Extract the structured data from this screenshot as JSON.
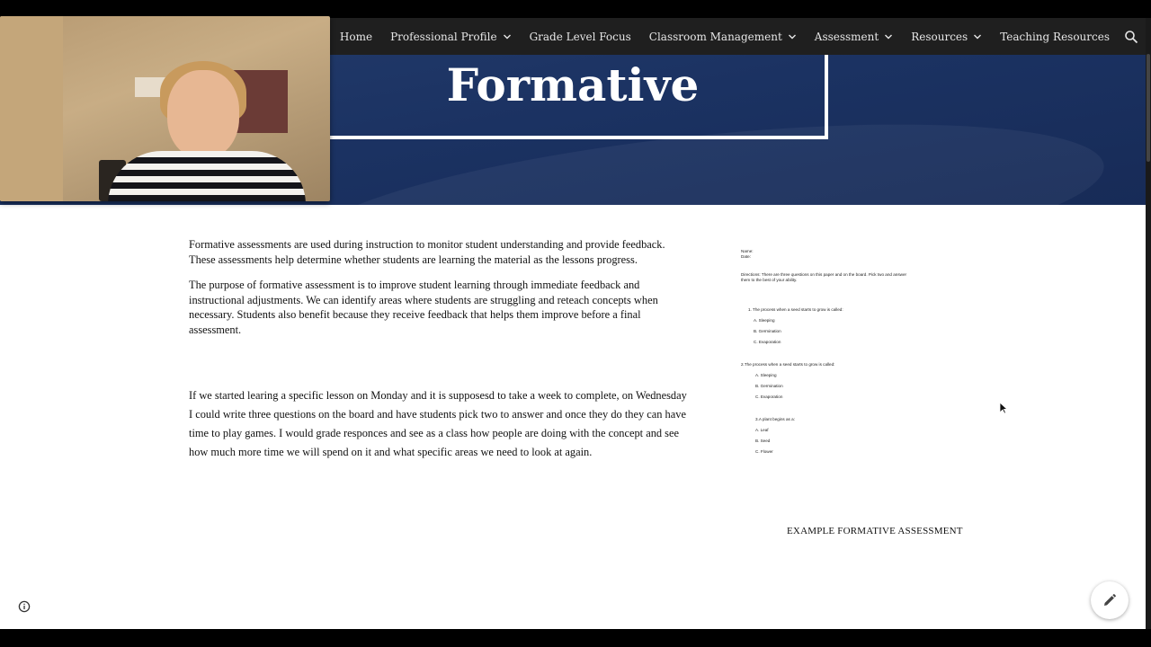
{
  "nav": {
    "items": [
      {
        "label": "Home",
        "dropdown": false
      },
      {
        "label": "Professional Profile",
        "dropdown": true
      },
      {
        "label": "Grade Level Focus",
        "dropdown": false
      },
      {
        "label": "Classroom Management",
        "dropdown": true
      },
      {
        "label": "Assessment",
        "dropdown": true
      },
      {
        "label": "Resources",
        "dropdown": true
      },
      {
        "label": "Teaching Resources",
        "dropdown": false
      }
    ],
    "search_icon": "search-icon"
  },
  "hero": {
    "title": "Formative",
    "color": "#1b3262"
  },
  "content": {
    "paragraph1": "Formative assessments are used during instruction to monitor student understanding and provide feedback. These assessments help determine whether students are learning the material as the lessons progress.",
    "paragraph2": "The purpose of formative assessment is to improve student learning through immediate feedback and instructional adjustments. We can identify areas where students are struggling and reteach concepts when necessary. Students also benefit because they receive feedback that helps them improve before a final assessment.",
    "paragraph3": "If we started learing a specific lesson on Monday and it is supposesd to take a week to complete, on Wednesday I could write three questions on the board and have students pick two to answer and once they do they can have time to play games. I would grade responces and see as a class how people are doing with the concept and see how much more time we will spend on it and what specific areas we need to look at again."
  },
  "worksheet": {
    "name": "Name:",
    "date": "Date:",
    "directions": "Directions: There are three questions on this paper and on the board. Pick two and answer",
    "directions2": "them to the best of your ability.",
    "q1": "1.    The process when a seed starts to grow is called:",
    "q1a": "A. Sleeping",
    "q1b": "B. Germination",
    "q1c": "C. Evaporation",
    "q2": "2.The process when a seed starts to grow is called:",
    "q2a": "A. Sleeping",
    "q2b": "B. Germination",
    "q2c": "C. Evaporation",
    "q3": "3.A plant begins as a:",
    "q3a": "A. Leaf",
    "q3b": "B. Seed",
    "q3c": "C. Flower"
  },
  "caption": "EXAMPLE FORMATIVE ASSESSMENT"
}
